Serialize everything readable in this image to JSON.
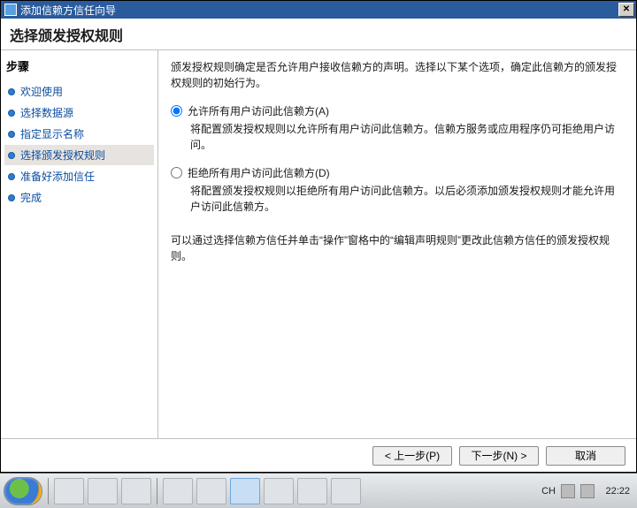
{
  "window": {
    "title": "添加信赖方信任向导"
  },
  "header": {
    "title": "选择颁发授权规则"
  },
  "sidebar": {
    "title": "步骤",
    "items": [
      {
        "label": "欢迎使用"
      },
      {
        "label": "选择数据源"
      },
      {
        "label": "指定显示名称"
      },
      {
        "label": "选择颁发授权规则"
      },
      {
        "label": "准备好添加信任"
      },
      {
        "label": "完成"
      }
    ]
  },
  "content": {
    "intro": "颁发授权规则确定是否允许用户接收信赖方的声明。选择以下某个选项，确定此信赖方的颁发授权规则的初始行为。",
    "option1_label": "允许所有用户访问此信赖方(A)",
    "option1_desc": "将配置颁发授权规则以允许所有用户访问此信赖方。信赖方服务或应用程序仍可拒绝用户访问。",
    "option2_label": "拒绝所有用户访问此信赖方(D)",
    "option2_desc": "将配置颁发授权规则以拒绝所有用户访问此信赖方。以后必须添加颁发授权规则才能允许用户访问此信赖方。",
    "note": "可以通过选择信赖方信任并单击“操作”窗格中的“编辑声明规则”更改此信赖方信任的颁发授权规则。"
  },
  "buttons": {
    "prev": "< 上一步(P)",
    "next": "下一步(N) >",
    "cancel": "取消"
  },
  "tray": {
    "ime": "CH",
    "clock": "22:22"
  }
}
